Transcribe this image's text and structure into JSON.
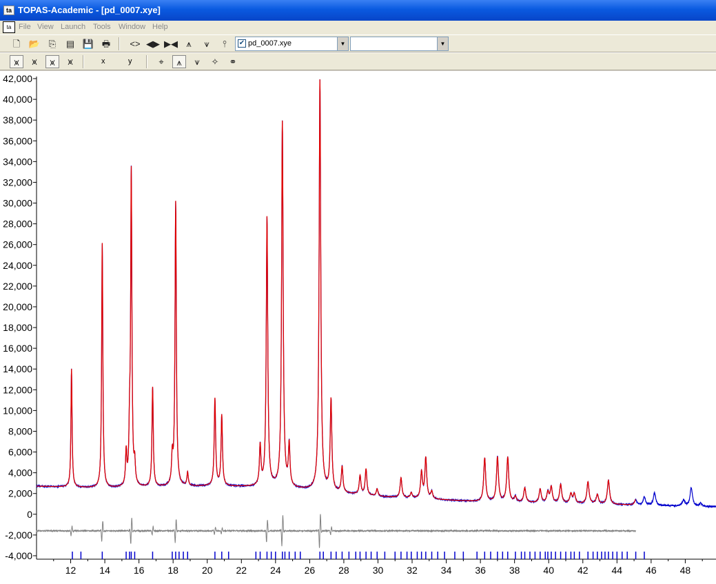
{
  "window": {
    "title": "TOPAS-Academic - [pd_0007.xye]",
    "icon_label": "ta"
  },
  "menu": {
    "system_icon_label": "ta",
    "items": [
      "File",
      "View",
      "Launch",
      "Tools",
      "Window",
      "Help"
    ]
  },
  "toolbar1": {
    "buttons": [
      {
        "name": "new-icon",
        "glyph": "🗋"
      },
      {
        "name": "open-folder-icon",
        "glyph": "📂"
      },
      {
        "name": "copy-icon",
        "glyph": "⎘"
      },
      {
        "name": "paste-icon",
        "glyph": "▤"
      },
      {
        "name": "save-icon",
        "glyph": "💾"
      },
      {
        "name": "print-icon",
        "glyph": "🖶"
      },
      {
        "name": "expand-horizontal-icon",
        "glyph": "<>"
      },
      {
        "name": "shift-left-right-icon",
        "glyph": "◀▶"
      },
      {
        "name": "collapse-horizontal-icon",
        "glyph": "▶◀"
      },
      {
        "name": "peaks-down-icon",
        "glyph": "⩚"
      },
      {
        "name": "peaks-up-icon",
        "glyph": "⩛"
      },
      {
        "name": "peaks-fit-icon",
        "glyph": "⫯"
      }
    ],
    "file_combo": {
      "checked": true,
      "value": "pd_0007.xye"
    },
    "second_combo": {
      "value": ""
    }
  },
  "toolbar2": {
    "buttons": [
      {
        "name": "pattern-red-icon",
        "glyph": "⩙",
        "color": "#cc0000"
      },
      {
        "name": "pattern-green-icon",
        "glyph": "⩙",
        "color": "#008000"
      },
      {
        "name": "pattern-blue-icon",
        "glyph": "⩙",
        "color": "#0000cc"
      },
      {
        "name": "pattern-dark-icon",
        "glyph": "⩙",
        "color": "#333333"
      }
    ],
    "x_label": "x",
    "y_label": "y",
    "tools": [
      {
        "name": "cursor-tool-icon",
        "glyph": "⌖"
      },
      {
        "name": "peak-select-icon",
        "glyph": "⩚"
      },
      {
        "name": "peak-insert-icon",
        "glyph": "⩛"
      },
      {
        "name": "magic-wand-icon",
        "glyph": "✧"
      },
      {
        "name": "binoculars-icon",
        "glyph": "⚭"
      }
    ]
  },
  "chart_data": {
    "type": "line",
    "title": "",
    "xlabel": "",
    "ylabel": "",
    "xlim": [
      10,
      49.8
    ],
    "ylim": [
      -4000,
      42000
    ],
    "x_ticks": [
      12,
      14,
      16,
      18,
      20,
      22,
      24,
      26,
      28,
      30,
      32,
      34,
      36,
      38,
      40,
      42,
      44,
      46,
      48
    ],
    "y_ticks": [
      42000,
      40000,
      38000,
      36000,
      34000,
      32000,
      30000,
      28000,
      26000,
      24000,
      22000,
      20000,
      18000,
      16000,
      14000,
      12000,
      10000,
      8000,
      6000,
      4000,
      2000,
      0,
      -2000,
      -4000
    ],
    "y_tick_labels": [
      "42,000",
      "40,000",
      "38,000",
      "36,000",
      "34,000",
      "32,000",
      "30,000",
      "28,000",
      "26,000",
      "24,000",
      "22,000",
      "20,000",
      "18,000",
      "16,000",
      "14,000",
      "12,000",
      "10,000",
      "8,000",
      "6,000",
      "4,000",
      "2,000",
      "0",
      "-2,000",
      "-4,000"
    ],
    "x_tick_labels": [
      "12",
      "14",
      "16",
      "18",
      "20",
      "22",
      "24",
      "26",
      "28",
      "30",
      "32",
      "34",
      "36",
      "38",
      "40",
      "42",
      "44",
      "46",
      "48"
    ],
    "colors": {
      "observed": "#0000cc",
      "calculated": "#e00000",
      "difference": "#808080",
      "reflections": "#0000cc"
    },
    "background": {
      "points": [
        [
          10,
          2700
        ],
        [
          14,
          2500
        ],
        [
          20,
          2700
        ],
        [
          24,
          2600
        ],
        [
          30,
          1700
        ],
        [
          36,
          1200
        ],
        [
          42,
          1000
        ],
        [
          49.8,
          700
        ]
      ]
    },
    "calc_end_x": 45.1,
    "peaks": [
      {
        "x": 12.05,
        "height": 11400
      },
      {
        "x": 13.85,
        "height": 23600
      },
      {
        "x": 15.25,
        "height": 3200
      },
      {
        "x": 15.45,
        "height": 4500
      },
      {
        "x": 15.55,
        "height": 30100
      },
      {
        "x": 15.75,
        "height": 2000
      },
      {
        "x": 16.8,
        "height": 9600
      },
      {
        "x": 17.95,
        "height": 2600
      },
      {
        "x": 18.15,
        "height": 27400
      },
      {
        "x": 18.85,
        "height": 1300
      },
      {
        "x": 20.45,
        "height": 8400
      },
      {
        "x": 20.85,
        "height": 6800
      },
      {
        "x": 23.1,
        "height": 3800
      },
      {
        "x": 23.5,
        "height": 25900
      },
      {
        "x": 24.4,
        "height": 35200
      },
      {
        "x": 24.8,
        "height": 4000
      },
      {
        "x": 26.6,
        "height": 39600
      },
      {
        "x": 27.25,
        "height": 8800
      },
      {
        "x": 27.9,
        "height": 2500
      },
      {
        "x": 28.95,
        "height": 1800
      },
      {
        "x": 29.3,
        "height": 2500
      },
      {
        "x": 29.95,
        "height": 700
      },
      {
        "x": 31.35,
        "height": 1900
      },
      {
        "x": 31.95,
        "height": 500
      },
      {
        "x": 32.55,
        "height": 2500
      },
      {
        "x": 32.8,
        "height": 3900
      },
      {
        "x": 33.15,
        "height": 700
      },
      {
        "x": 36.25,
        "height": 4200
      },
      {
        "x": 37.0,
        "height": 4300
      },
      {
        "x": 37.6,
        "height": 4300
      },
      {
        "x": 38.05,
        "height": 500
      },
      {
        "x": 38.6,
        "height": 1400
      },
      {
        "x": 39.5,
        "height": 1300
      },
      {
        "x": 39.95,
        "height": 1000
      },
      {
        "x": 40.15,
        "height": 1500
      },
      {
        "x": 40.7,
        "height": 1800
      },
      {
        "x": 41.3,
        "height": 900
      },
      {
        "x": 41.5,
        "height": 900
      },
      {
        "x": 42.3,
        "height": 2100
      },
      {
        "x": 42.85,
        "height": 900
      },
      {
        "x": 43.5,
        "height": 2300
      },
      {
        "x": 45.1,
        "height": 500
      },
      {
        "x": 45.6,
        "height": 800
      },
      {
        "x": 46.2,
        "height": 1200
      },
      {
        "x": 47.9,
        "height": 600
      },
      {
        "x": 48.35,
        "height": 1800
      },
      {
        "x": 48.9,
        "height": 300
      }
    ],
    "reflections_x": [
      12.1,
      12.6,
      13.85,
      15.25,
      15.45,
      15.55,
      15.75,
      16.8,
      17.95,
      18.15,
      18.35,
      18.6,
      18.85,
      20.45,
      20.85,
      21.25,
      22.85,
      23.1,
      23.5,
      23.75,
      24.0,
      24.4,
      24.55,
      24.8,
      25.15,
      25.45,
      26.6,
      26.8,
      27.25,
      27.55,
      27.9,
      28.3,
      28.7,
      28.95,
      29.3,
      29.6,
      29.95,
      30.4,
      31.0,
      31.35,
      31.7,
      31.95,
      32.3,
      32.55,
      32.8,
      33.15,
      33.5,
      33.9,
      34.5,
      35.0,
      35.8,
      36.25,
      36.6,
      37.0,
      37.3,
      37.6,
      38.05,
      38.4,
      38.6,
      38.9,
      39.2,
      39.5,
      39.8,
      39.95,
      40.15,
      40.4,
      40.7,
      41.0,
      41.3,
      41.5,
      41.8,
      42.3,
      42.6,
      42.85,
      43.1,
      43.3,
      43.5,
      43.75,
      44.0,
      44.3,
      44.6,
      45.1,
      45.6
    ]
  }
}
